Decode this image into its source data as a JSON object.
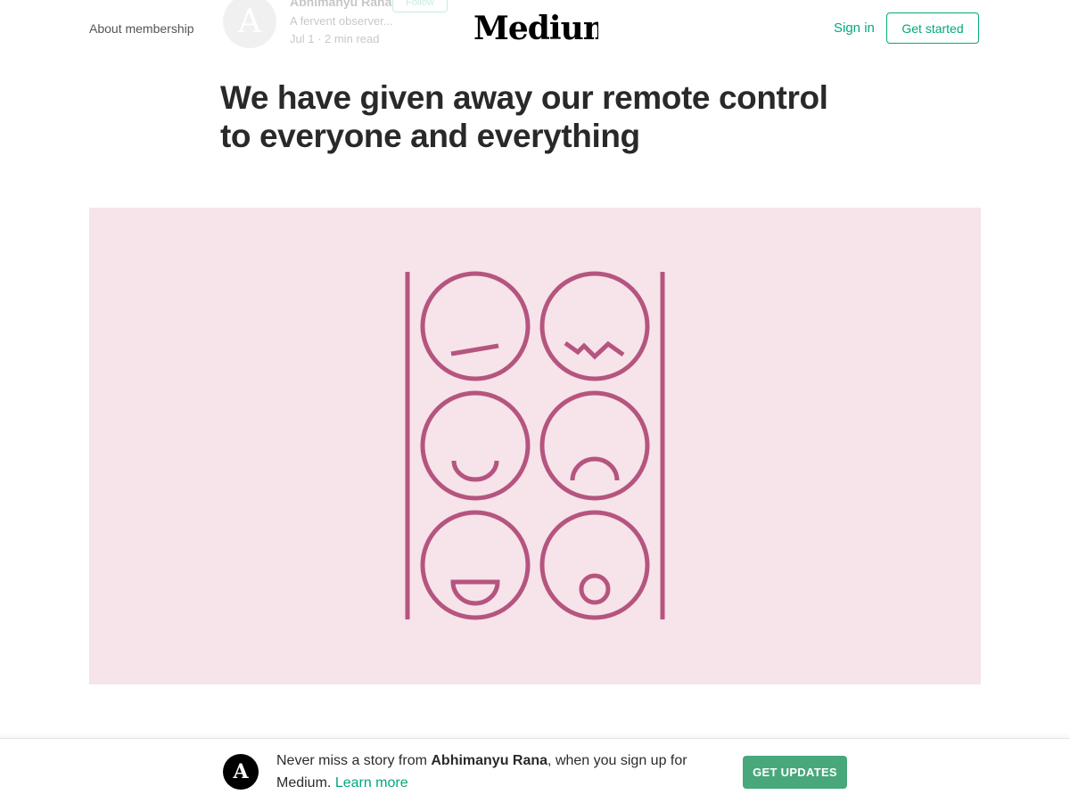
{
  "header": {
    "about_link": "About membership",
    "logo_text": "Medium",
    "signin_label": "Sign in",
    "get_started_label": "Get started"
  },
  "author_ghost": {
    "avatar_initial": "A",
    "name": "Abhimanyu Rana",
    "follow_label": "Follow",
    "bio": "A fervent observer...",
    "meta": "Jul 1 · 2 min read"
  },
  "article": {
    "title": "We have given away our remote control to everyone and everything"
  },
  "hero": {
    "background_color": "#f7e3ea",
    "stroke_color": "#b5557f",
    "faces": [
      "flat-face-icon",
      "wavy-mouth-face-icon",
      "smiling-face-icon",
      "frowning-face-icon",
      "laughing-face-icon",
      "surprised-face-icon"
    ]
  },
  "banner": {
    "avatar_initial": "A",
    "msg_prefix": "Never miss a story from ",
    "author_name": "Abhimanyu Rana",
    "msg_middle": ", when you sign up for Medium.",
    "learn_more": "Learn more",
    "button_label": "GET UPDATES"
  },
  "colors": {
    "accent": "#03a87c",
    "button_green": "#48a87b"
  }
}
